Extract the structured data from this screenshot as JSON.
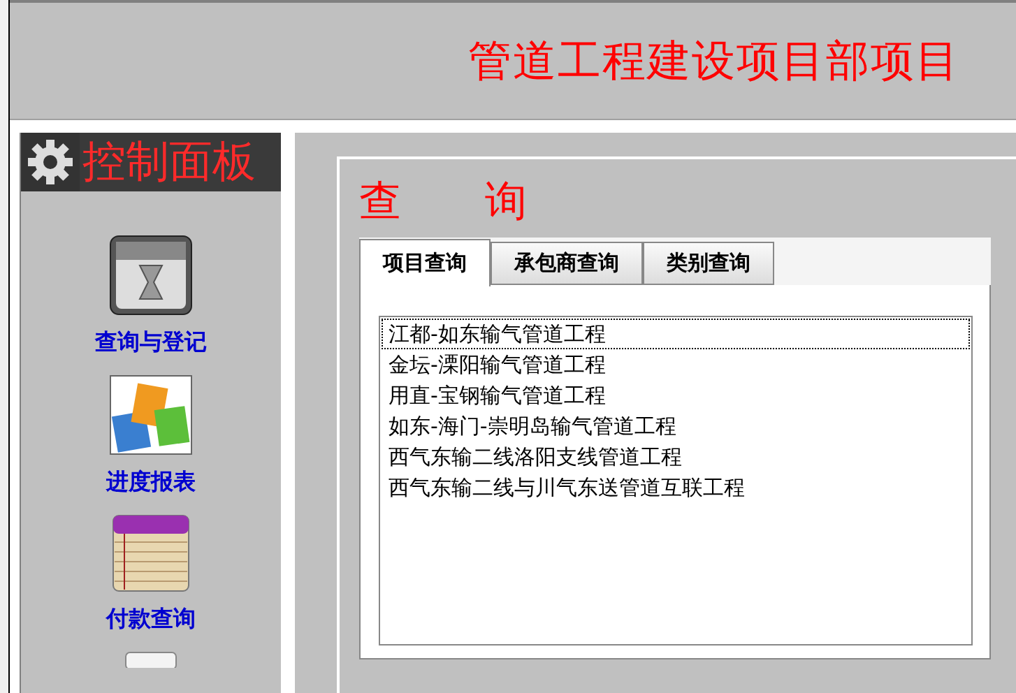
{
  "header": {
    "title": "管道工程建设项目部项目"
  },
  "control_panel": {
    "title": "控制面板",
    "items": [
      {
        "label": "查询与登记",
        "kind": "hourglass"
      },
      {
        "label": "进度报表",
        "kind": "letters"
      },
      {
        "label": "付款查询",
        "kind": "notepad"
      }
    ]
  },
  "query_panel": {
    "title": "查　　询",
    "tabs": [
      {
        "label": "项目查询",
        "selected": true
      },
      {
        "label": "承包商查询",
        "selected": false
      },
      {
        "label": "类别查询",
        "selected": false
      }
    ],
    "list": [
      {
        "text": "江都-如东输气管道工程",
        "focused": true
      },
      {
        "text": "金坛-溧阳输气管道工程",
        "focused": false
      },
      {
        "text": "用直-宝钢输气管道工程",
        "focused": false
      },
      {
        "text": "如东-海门-崇明岛输气管道工程",
        "focused": false
      },
      {
        "text": "西气东输二线洛阳支线管道工程",
        "focused": false
      },
      {
        "text": "西气东输二线与川气东送管道互联工程",
        "focused": false
      }
    ]
  }
}
